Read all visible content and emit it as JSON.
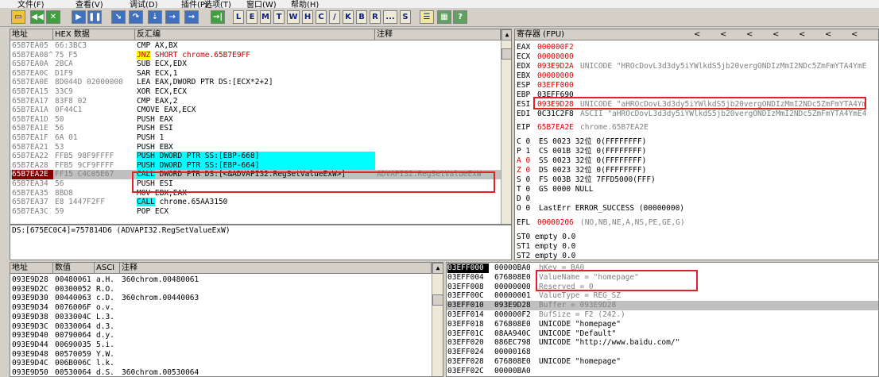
{
  "menu": {
    "file": "文件(F)",
    "view": "查看(V)",
    "debug": "调试(D)",
    "plugin": "插件(P)",
    "options": "选项(T)",
    "window": "窗口(W)",
    "help": "帮助(H)"
  },
  "toolbar": {
    "letters": [
      "L",
      "E",
      "M",
      "T",
      "W",
      "H",
      "C",
      "/",
      "K",
      "B",
      "R",
      "...",
      "S"
    ]
  },
  "disasm": {
    "headers": {
      "address": "地址",
      "hex": "HEX 数据",
      "disasm": "反汇编",
      "comment": "注释"
    },
    "rows": [
      {
        "addr": "65B7EA05",
        "mark": "",
        "hex": "66:3BC3",
        "asm": "CMP AX,BX",
        "comment": ""
      },
      {
        "addr": "65B7EA08",
        "mark": "^",
        "hex": "75 F5",
        "asm": "JNZ SHORT chrome.65B7E9FF",
        "comment": ""
      },
      {
        "addr": "65B7EA0A",
        "mark": "",
        "hex": "2BCA",
        "asm": "SUB ECX,EDX",
        "comment": ""
      },
      {
        "addr": "65B7EA0C",
        "mark": "",
        "hex": "D1F9",
        "asm": "SAR ECX,1",
        "comment": ""
      },
      {
        "addr": "65B7EA0E",
        "mark": "",
        "hex": "8D044D 02000000",
        "asm": "LEA EAX,DWORD PTR DS:[ECX*2+2]",
        "comment": ""
      },
      {
        "addr": "65B7EA15",
        "mark": "",
        "hex": "33C9",
        "asm": "XOR ECX,ECX",
        "comment": ""
      },
      {
        "addr": "65B7EA17",
        "mark": "",
        "hex": "83F8 02",
        "asm": "CMP EAX,2",
        "comment": ""
      },
      {
        "addr": "65B7EA1A",
        "mark": "",
        "hex": "0F44C1",
        "asm": "CMOVE EAX,ECX",
        "comment": ""
      },
      {
        "addr": "65B7EA1D",
        "mark": "",
        "hex": "50",
        "asm": "PUSH EAX",
        "comment": ""
      },
      {
        "addr": "65B7EA1E",
        "mark": "",
        "hex": "56",
        "asm": "PUSH ESI",
        "comment": ""
      },
      {
        "addr": "65B7EA1F",
        "mark": "",
        "hex": "6A 01",
        "asm": "PUSH 1",
        "comment": ""
      },
      {
        "addr": "65B7EA21",
        "mark": "",
        "hex": "53",
        "asm": "PUSH EBX",
        "comment": ""
      },
      {
        "addr": "65B7EA22",
        "mark": "",
        "hex": "FFB5 98F9FFFF",
        "asm": "PUSH DWORD PTR SS:[EBP-668]",
        "comment": ""
      },
      {
        "addr": "65B7EA28",
        "mark": "",
        "hex": "FFB5 9CF9FFFF",
        "asm": "PUSH DWORD PTR SS:[EBP-664]",
        "comment": ""
      },
      {
        "addr": "65B7EA2E",
        "mark": "",
        "hex": "FF15 C4C05E67",
        "asm": "CALL DWORD PTR DS:[<&ADVAPI32.RegSetValueExW>]",
        "comment": "ADVAPI32.RegSetValueExW"
      },
      {
        "addr": "65B7EA34",
        "mark": "",
        "hex": "56",
        "asm": "PUSH ESI",
        "comment": ""
      },
      {
        "addr": "65B7EA35",
        "mark": "",
        "hex": "8BD8",
        "asm": "MOV EBX,EAX",
        "comment": ""
      },
      {
        "addr": "65B7EA37",
        "mark": "",
        "hex": "E8 1447F2FF",
        "asm": "CALL chrome.65AA3150",
        "comment": ""
      },
      {
        "addr": "65B7EA3C",
        "mark": "",
        "hex": "59",
        "asm": "POP ECX",
        "comment": ""
      }
    ],
    "info": "DS:[675EC0C4]=757814D6 (ADVAPI32.RegSetValueExW)"
  },
  "registers": {
    "title": "寄存器 (FPU)",
    "nav": [
      "<",
      "<",
      "<",
      "<",
      "<",
      "<",
      "<"
    ],
    "gprs": [
      {
        "name": "EAX",
        "val": "000000F2",
        "note": ""
      },
      {
        "name": "ECX",
        "val": "00000000",
        "note": ""
      },
      {
        "name": "EDX",
        "val": "093E9D2A",
        "note": "UNICODE \"HROcDovL3d3dy5iYWlkdS5jb20vergONDIzMmI2NDc5ZmFmYTA4YmE"
      },
      {
        "name": "EBX",
        "val": "00000000",
        "note": ""
      },
      {
        "name": "ESP",
        "val": "03EFF000",
        "note": ""
      },
      {
        "name": "EBP",
        "val": "03EFF690",
        "note": ""
      },
      {
        "name": "ESI",
        "val": "093E9D28",
        "note": "UNICODE \"aHROcDovL3d3dy5iYWlkdS5jb20vergONDIzMmI2NDc5ZmFmYTA4Ym"
      },
      {
        "name": "EDI",
        "val": "0C31C2F8",
        "note": "ASCII \"aHROcDovL3d3dy5iYWlkdS5jb20vergONDIzMmI2NDc5ZmFmYTA4YmE4"
      }
    ],
    "eip": {
      "name": "EIP",
      "val": "65B7EA2E",
      "note": "chrome.65B7EA2E"
    },
    "flags": [
      {
        "f": "C 0",
        "seg": "ES 0023 32位 0(FFFFFFFF)"
      },
      {
        "f": "P 1",
        "seg": "CS 001B 32位 0(FFFFFFFF)"
      },
      {
        "f": "A 0",
        "seg": "SS 0023 32位 0(FFFFFFFF)"
      },
      {
        "f": "Z 0",
        "seg": "DS 0023 32位 0(FFFFFFFF)"
      },
      {
        "f": "S 0",
        "seg": "FS 003B 32位 7FFD5000(FFF)"
      },
      {
        "f": "T 0",
        "seg": "GS 0000 NULL"
      },
      {
        "f": "D 0",
        "seg": ""
      },
      {
        "f": "O 0",
        "seg": "LastErr ERROR_SUCCESS (00000000)"
      }
    ],
    "efl": {
      "name": "EFL",
      "val": "00000206",
      "note": "(NO,NB,NE,A,NS,PE,GE,G)"
    },
    "fpu": [
      "ST0 empty 0.0",
      "ST1 empty 0.0",
      "ST2 empty 0.0"
    ]
  },
  "dump": {
    "headers": {
      "address": "地址",
      "value": "数值",
      "ascii": "ASCI",
      "comment": "注释"
    },
    "rows": [
      {
        "addr": "093E9D28",
        "val": "00480061",
        "ascii": "a.H.",
        "comment": "360chrom.00480061"
      },
      {
        "addr": "093E9D2C",
        "val": "00300052",
        "ascii": "R.O.",
        "comment": ""
      },
      {
        "addr": "093E9D30",
        "val": "00440063",
        "ascii": "c.D.",
        "comment": "360chrom.00440063"
      },
      {
        "addr": "093E9D34",
        "val": "0076006F",
        "ascii": "o.v.",
        "comment": ""
      },
      {
        "addr": "093E9D38",
        "val": "0033004C",
        "ascii": "L.3.",
        "comment": ""
      },
      {
        "addr": "093E9D3C",
        "val": "00330064",
        "ascii": "d.3.",
        "comment": ""
      },
      {
        "addr": "093E9D40",
        "val": "00790064",
        "ascii": "d.y.",
        "comment": ""
      },
      {
        "addr": "093E9D44",
        "val": "00690035",
        "ascii": "5.i.",
        "comment": ""
      },
      {
        "addr": "093E9D48",
        "val": "00570059",
        "ascii": "Y.W.",
        "comment": ""
      },
      {
        "addr": "093E9D4C",
        "val": "006B006C",
        "ascii": "l.k.",
        "comment": ""
      },
      {
        "addr": "093E9D50",
        "val": "00530064",
        "ascii": "d.S.",
        "comment": "360chrom.00530064"
      }
    ]
  },
  "stack": {
    "rows": [
      {
        "addr": "03EFF000",
        "val": "00000BA0",
        "comment": "hKey = BA0"
      },
      {
        "addr": "03EFF004",
        "val": "676808E0",
        "comment": "ValueName = \"homepage\""
      },
      {
        "addr": "03EFF008",
        "val": "00000000",
        "comment": "Reserved = 0"
      },
      {
        "addr": "03EFF00C",
        "val": "00000001",
        "comment": "ValueType = REG_SZ"
      },
      {
        "addr": "03EFF010",
        "val": "093E9D28",
        "comment": "Buffer = 093E9D28"
      },
      {
        "addr": "03EFF014",
        "val": "000000F2",
        "comment": "BufSize = F2 (242.)"
      },
      {
        "addr": "03EFF018",
        "val": "676808E0",
        "comment": "UNICODE \"homepage\""
      },
      {
        "addr": "03EFF01C",
        "val": "08AA940C",
        "comment": "UNICODE \"Default\""
      },
      {
        "addr": "03EFF020",
        "val": "086EC798",
        "comment": "UNICODE \"http://www.baidu.com/\""
      },
      {
        "addr": "03EFF024",
        "val": "00000168",
        "comment": ""
      },
      {
        "addr": "03EFF028",
        "val": "676808E0",
        "comment": "UNICODE \"homepage\""
      },
      {
        "addr": "03EFF02C",
        "val": "00000BA0",
        "comment": ""
      }
    ]
  },
  "colors": {
    "highlight_red": "#e0202a",
    "call_cyan": "#00ffff",
    "jnz_yellow": "#ffff00",
    "current_row": "#800000",
    "changed_reg": "#e00000"
  }
}
